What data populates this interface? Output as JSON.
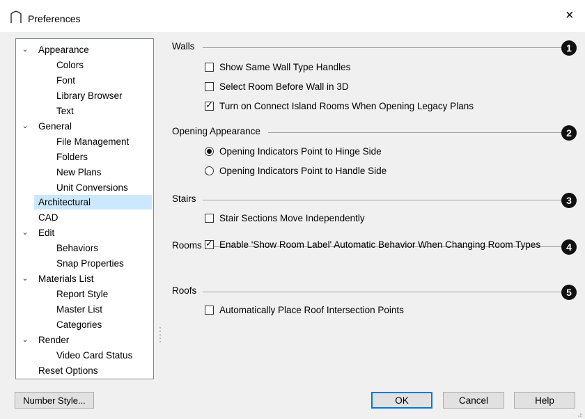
{
  "window": {
    "title": "Preferences",
    "close_glyph": "×"
  },
  "tree": {
    "items": [
      {
        "label": "Appearance",
        "level": 0,
        "expanded": true
      },
      {
        "label": "Colors",
        "level": 1
      },
      {
        "label": "Font",
        "level": 1
      },
      {
        "label": "Library Browser",
        "level": 1
      },
      {
        "label": "Text",
        "level": 1
      },
      {
        "label": "General",
        "level": 0,
        "expanded": true
      },
      {
        "label": "File Management",
        "level": 1
      },
      {
        "label": "Folders",
        "level": 1
      },
      {
        "label": "New Plans",
        "level": 1
      },
      {
        "label": "Unit Conversions",
        "level": 1
      },
      {
        "label": "Architectural",
        "level": 0,
        "selected": true
      },
      {
        "label": "CAD",
        "level": 0
      },
      {
        "label": "Edit",
        "level": 0,
        "expanded": true
      },
      {
        "label": "Behaviors",
        "level": 1
      },
      {
        "label": "Snap Properties",
        "level": 1
      },
      {
        "label": "Materials List",
        "level": 0,
        "expanded": true
      },
      {
        "label": "Report Style",
        "level": 1
      },
      {
        "label": "Master List",
        "level": 1
      },
      {
        "label": "Categories",
        "level": 1
      },
      {
        "label": "Render",
        "level": 0,
        "expanded": true
      },
      {
        "label": "Video Card Status",
        "level": 1
      },
      {
        "label": "Reset Options",
        "level": 0
      }
    ]
  },
  "sections": {
    "walls": {
      "title": "Walls",
      "badge": "1",
      "options": [
        {
          "label": "Show Same Wall Type Handles",
          "checked": false
        },
        {
          "label": "Select Room Before Wall in 3D",
          "checked": false
        },
        {
          "label": "Turn on Connect Island Rooms When Opening Legacy Plans",
          "checked": true
        }
      ]
    },
    "opening": {
      "title": "Opening Appearance",
      "badge": "2",
      "options": [
        {
          "label": "Opening Indicators Point to Hinge Side",
          "selected": true
        },
        {
          "label": "Opening Indicators Point to Handle Side",
          "selected": false
        }
      ]
    },
    "stairs": {
      "title": "Stairs",
      "badge": "3",
      "options": [
        {
          "label": "Stair Sections Move Independently",
          "checked": false
        }
      ]
    },
    "rooms": {
      "title": "Rooms",
      "badge": "4",
      "options": [
        {
          "label": "Enable 'Show Room Label' Automatic Behavior When Changing Room Types",
          "checked": true
        }
      ]
    },
    "roofs": {
      "title": "Roofs",
      "badge": "5",
      "options": [
        {
          "label": "Automatically Place Roof Intersection Points",
          "checked": false
        }
      ]
    }
  },
  "buttons": {
    "number_style": "Number Style...",
    "ok": "OK",
    "cancel": "Cancel",
    "help": "Help"
  },
  "glyphs": {
    "checkmark": "✓",
    "chevron": "⌄"
  },
  "colors": {
    "selection": "#cce8ff",
    "default_button_border": "#0078d7",
    "dialog_bg": "#f0f0f0"
  }
}
